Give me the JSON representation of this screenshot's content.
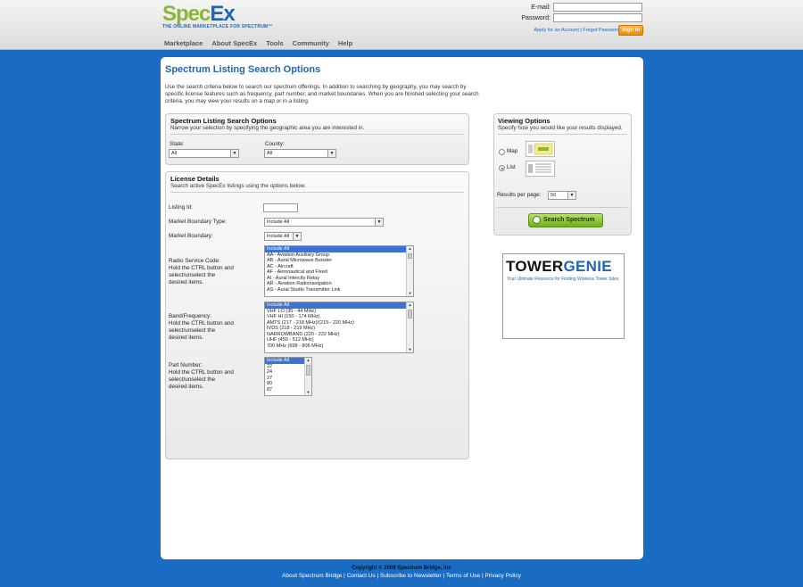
{
  "logo": {
    "spec": "Spec",
    "ex": "Ex",
    "tagline": "THE ONLINE MARKETPLACE FOR SPECTRUM™"
  },
  "nav": [
    "Marketplace",
    "About SpecEx",
    "Tools",
    "Community",
    "Help"
  ],
  "login": {
    "email_label": "E-mail:",
    "password_label": "Password:",
    "apply": "Apply for an Account",
    "forgot": "Forgot Password?",
    "signin": "Sign In"
  },
  "page": {
    "title": "Spectrum Listing Search Options",
    "intro": "Use the search criteria below to search our spectrum offerings. In addition to searching by geography, you may search by specific license features such as frequency, part number, and market boundaries. When you are finished selecting your search criteria, you may view your results on a map or in a listing."
  },
  "geo": {
    "title": "Spectrum Listing Search Options",
    "subtitle": "Narrow your selection by specifying the geographic area you are interested in.",
    "state_label": "State:",
    "state_value": "All",
    "county_label": "County:",
    "county_value": "All"
  },
  "license": {
    "title": "License Details",
    "subtitle": "Search active SpecEx listings using the options below.",
    "listing_id_label": "Listing Id:",
    "mbt_label": "Market Boundary Type:",
    "mbt_value": "Include All",
    "mb_label": "Market Boundary:",
    "mb_value": "Include All",
    "rsc_label": [
      "Radio Service Code:",
      "Hold the CTRL button and",
      "select/unselect the",
      "desired items."
    ],
    "rsc_options": [
      "Include All",
      "AA - Aviation Auxiliary Group",
      "AB - Aural Microwave Booster",
      "AC - Aircraft",
      "AF - Aeronautical and Fixed",
      "AI - Aural Intercity Relay",
      "AR - Aviation Radionavigation",
      "AS - Aural Studio Transmitter Link"
    ],
    "band_label": [
      "Band/Frequency:",
      "Hold the CTRL button and",
      "select/unselect the",
      "desired items."
    ],
    "band_options": [
      "Include All",
      "VHF LO (35 - 44 MHz)",
      "VHF HI (150 - 174 MHz)",
      "AMTS (217 - 218 MHz)/(219 - 220 MHz)",
      "IVDS (218 - 219 MHz)",
      "NARROWBAND (220 - 222 MHz)",
      "UHF (450 - 512 MHz)",
      "700 MHz (698 - 806 MHz)"
    ],
    "part_label": [
      "Part Number:",
      "Hold the CTRL button and",
      "select/unselect the",
      "desired items."
    ],
    "part_options": [
      "Include All",
      "22",
      "24",
      "27",
      "80",
      "87"
    ]
  },
  "viewing": {
    "title": "Viewing Options",
    "subtitle": "Specify how you would like your results displayed.",
    "map_label": "Map",
    "list_label": "List",
    "selected": "List",
    "rpp_label": "Results per page:",
    "rpp_value": "50",
    "search_button": "Search Spectrum"
  },
  "ad": {
    "t1": "TOWER",
    "t2": "GENIE",
    "sub": "Your Ultimate Resource for Finding Wireless Tower Sites"
  },
  "footer": {
    "copyright": "Copyright © 2009 Spectrum Bridge, Inc",
    "links": [
      "About Spectrum Bridge",
      "Contact Us",
      "Subscribe to Newsletter",
      "Terms of Use",
      "Privacy Policy"
    ]
  },
  "colors": {
    "background": "#1a6cc2",
    "title_blue": "#1f66b7",
    "accent_orange": "#f08a00",
    "button_green": "#6fae1e"
  }
}
